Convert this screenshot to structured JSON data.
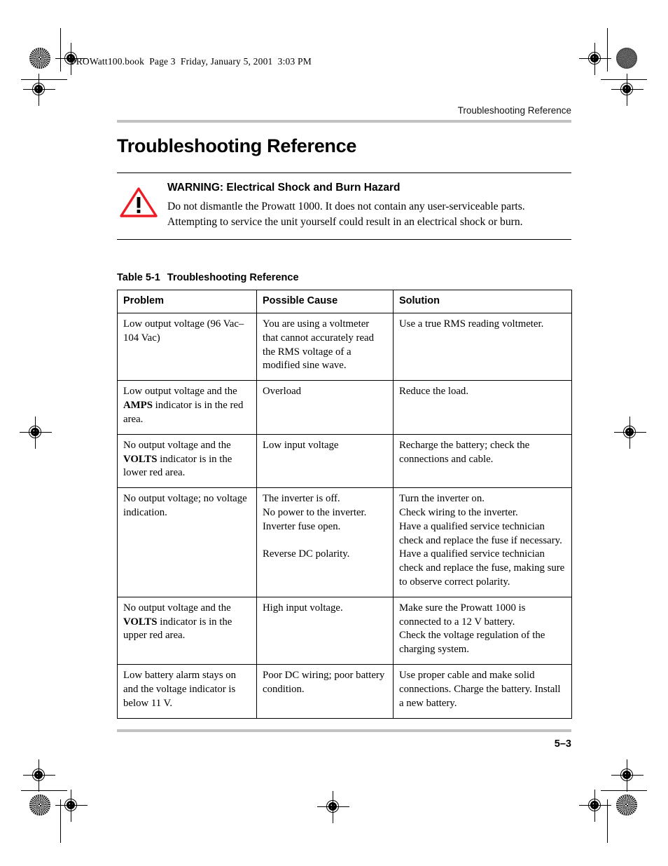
{
  "slug_line": "PROWatt100.book  Page 3  Friday, January 5, 2001  3:03 PM",
  "running_head": "Troubleshooting Reference",
  "chapter_title": "Troubleshooting Reference",
  "warning": {
    "icon": "warning-triangle-icon",
    "title": "WARNING: Electrical Shock and Burn Hazard",
    "body": "Do not dismantle the Prowatt 1000. It does not contain any user-serviceable parts. Attempting to service the unit yourself could result in an electrical shock or burn.",
    "accent_color": "#ee1c25"
  },
  "table": {
    "caption_number": "Table 5-1",
    "caption_text": "Troubleshooting Reference",
    "headers": [
      "Problem",
      "Possible Cause",
      "Solution"
    ],
    "rows": [
      {
        "problem_html": "Low output voltage (96 Vac&#8211;104 Vac)",
        "cause_html": "You are using a voltmeter that cannot accurately read the RMS voltage of a modified sine wave.",
        "solution_html": "Use a true RMS reading voltmeter."
      },
      {
        "problem_html": "Low output voltage and the <span class=\"b\">AMPS</span> indicator is in the red area.",
        "cause_html": "Overload",
        "solution_html": "Reduce the load."
      },
      {
        "problem_html": "No output voltage and the <span class=\"b\">VOLTS</span> indicator is in the lower red area.",
        "cause_html": "Low input voltage",
        "solution_html": "Recharge the battery; check the connections and cable."
      },
      {
        "problem_html": "No output voltage; no voltage indication.",
        "cause_html": "The inverter is off.<br>No power to the inverter.<br>Inverter fuse open.<span class=\"gap\"></span>Reverse DC polarity.",
        "solution_html": "Turn the inverter on.<br>Check wiring to the inverter.<br>Have a qualified service technician check and replace the fuse if necessary.<br>Have a qualified service technician check and replace the fuse, making sure to observe correct polarity."
      },
      {
        "problem_html": "No output voltage and the <span class=\"b\">VOLTS</span> indicator is in the upper red area.",
        "cause_html": "High input voltage.",
        "solution_html": "Make sure the Prowatt 1000 is connected to a 12 V battery.<br>Check the voltage regulation of the charging system."
      },
      {
        "problem_html": "Low battery alarm stays on and the voltage indicator is below 11 V.",
        "cause_html": "Poor DC wiring; poor battery condition.",
        "solution_html": "Use proper cable and make solid connections. Charge the battery. Install a new battery."
      }
    ]
  },
  "footer": {
    "page_number": "5–3"
  },
  "print_marks": {
    "registration_icon": "registration-target-icon",
    "rosette_icon": "color-rosette-icon"
  }
}
